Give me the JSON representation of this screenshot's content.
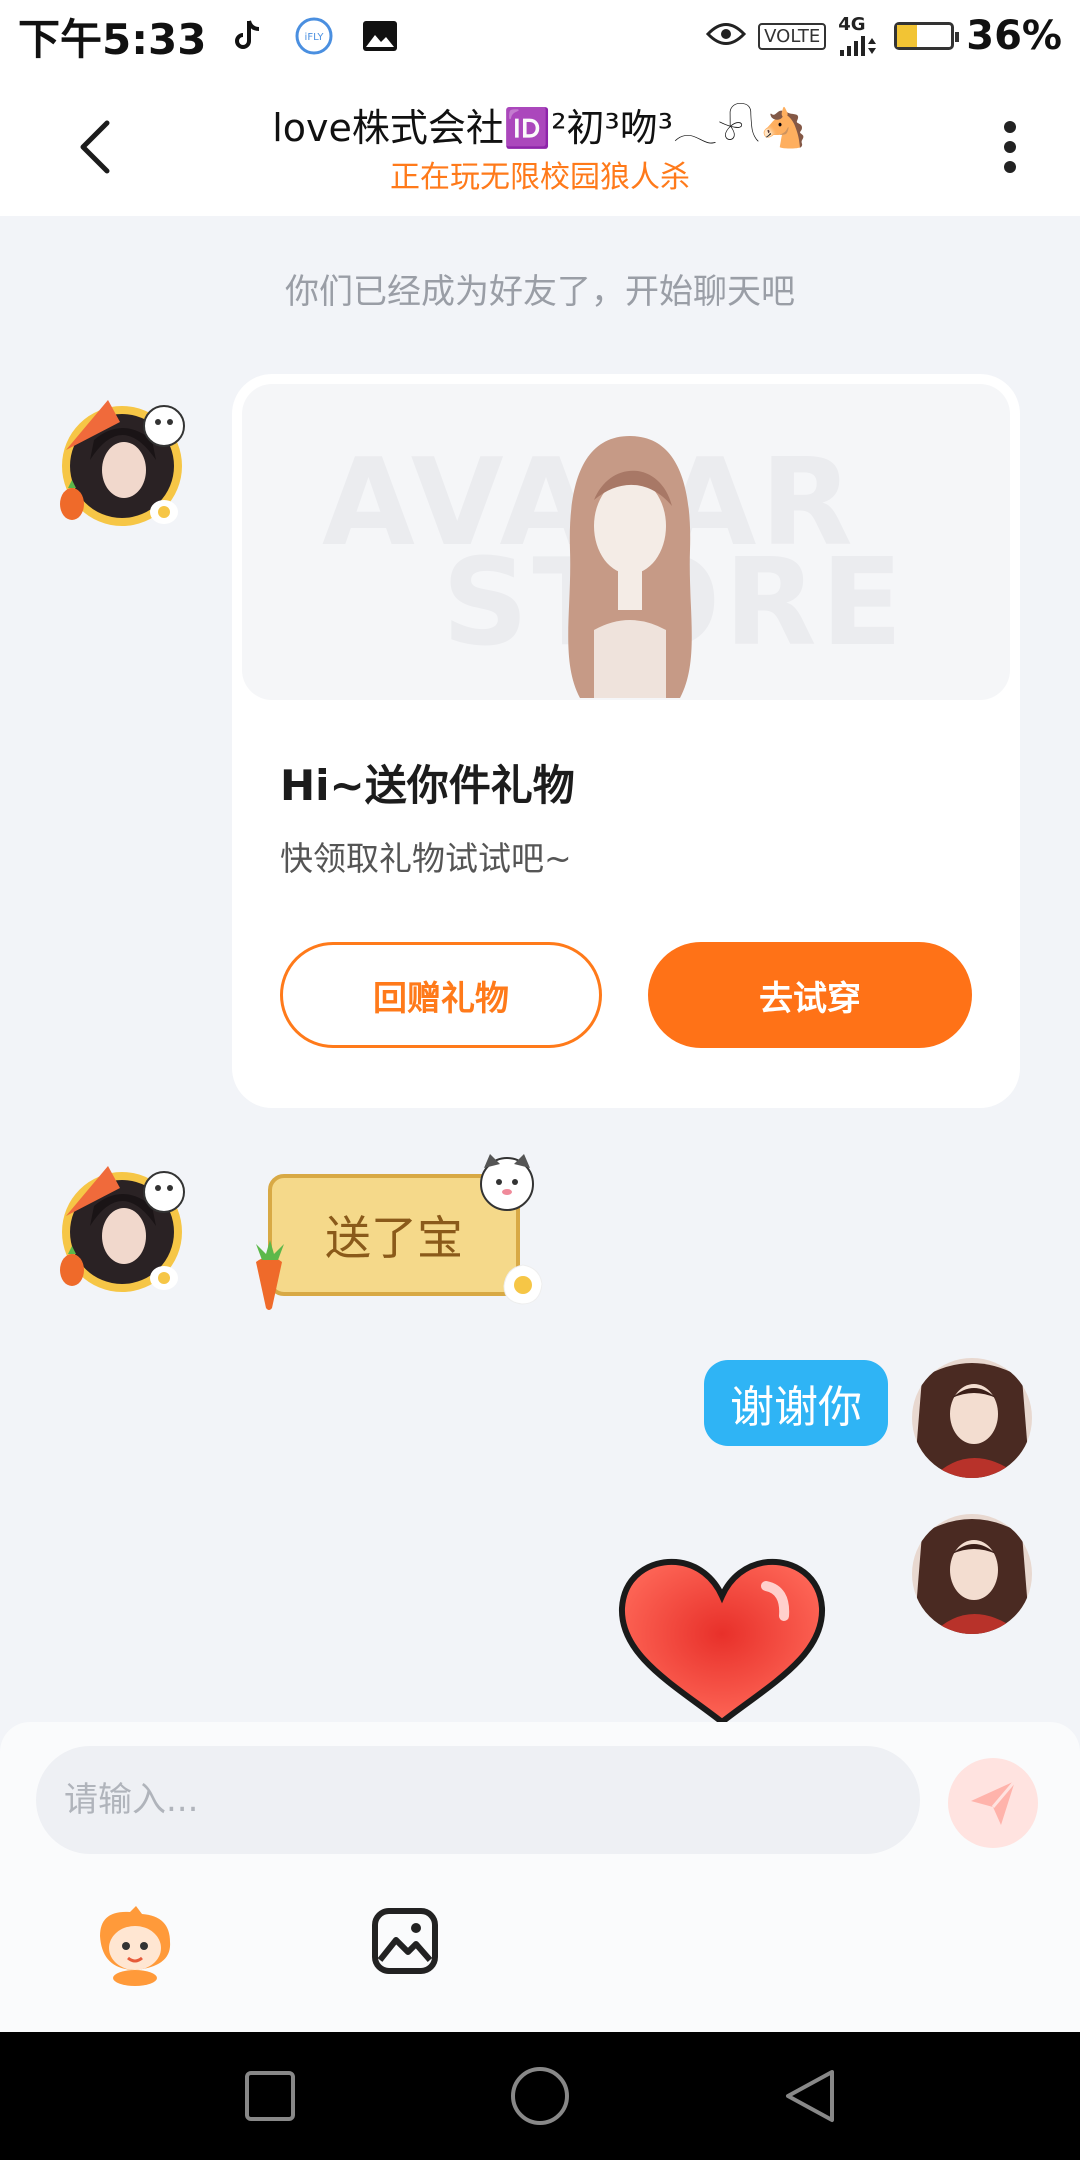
{
  "status_bar": {
    "time": "下午5:33",
    "left_icons": [
      "tiktok-icon",
      "ifly-icon",
      "gallery-icon"
    ],
    "ifly_label": "iFLY",
    "volte": "VOLTE",
    "network": "4G",
    "battery_percent": "36%",
    "battery_level": 0.36
  },
  "header": {
    "title": "love株式会社🆔²初³吻³𓂃𓍯🐴",
    "subtitle": "正在玩无限校园狼人杀"
  },
  "chat": {
    "system_message": "你们已经成为好友了，开始聊天吧",
    "gift_card": {
      "watermark_line1": "AVATAR",
      "watermark_line2": "STORE",
      "title": "Hi~送你件礼物",
      "description": "快领取礼物试试吧~",
      "return_gift_button": "回赠礼物",
      "try_on_button": "去试穿"
    },
    "sticker_text": "送了宝",
    "outgoing_message": "谢谢你"
  },
  "input": {
    "placeholder": "请输入..."
  },
  "colors": {
    "accent": "#ff7217",
    "bubble_blue": "#2fb4f5",
    "background": "#f2f4f8"
  }
}
